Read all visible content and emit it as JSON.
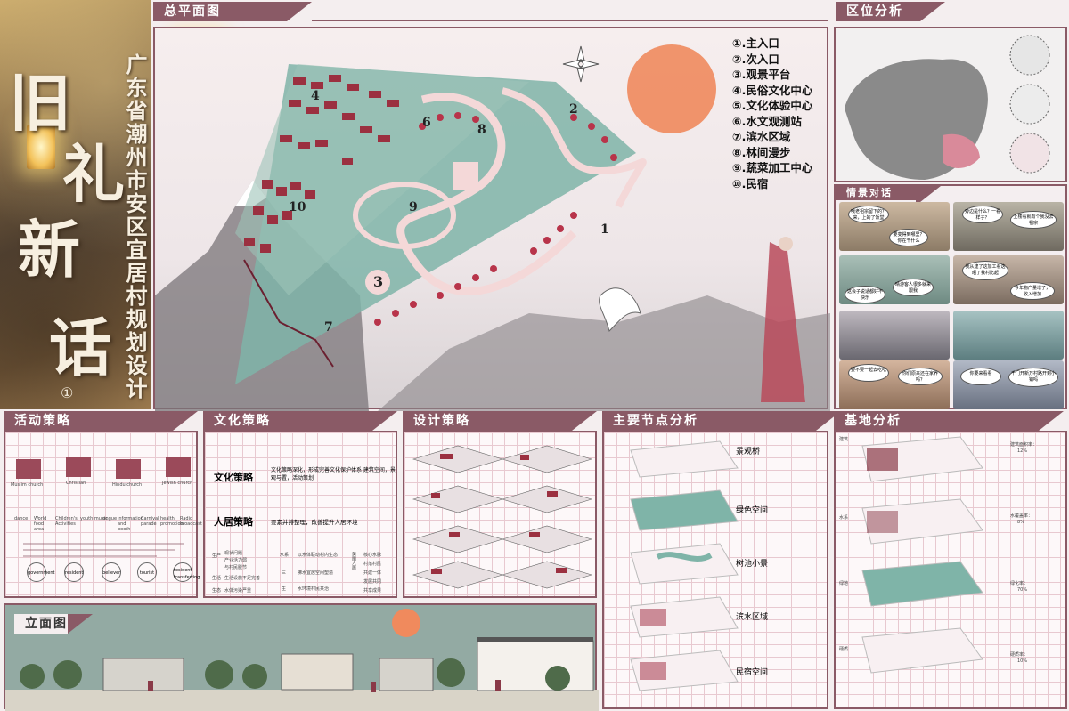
{
  "title_art": {
    "big_chars": [
      "旧",
      "礼",
      "新",
      "话"
    ],
    "vertical_title": "广东省潮州市安区宜居村规划设计",
    "number_mark": "①"
  },
  "sections": {
    "master_plan": "总平面图",
    "location": "区位分析",
    "scene_dialog": "情景对话",
    "activity": "活动策略",
    "culture": "文化策略",
    "design": "设计策略",
    "nodes": "主要节点分析",
    "site": "基地分析",
    "elevation": "立面图"
  },
  "legend": [
    "①.主入口",
    "②.次入口",
    "③.观景平台",
    "④.民俗文化中心",
    "⑤.文化体验中心",
    "⑥.水文观测站",
    "⑦.滨水区域",
    "⑧.林间漫步",
    "⑨.蔬菜加工中心",
    "⑩.民宿"
  ],
  "plan_numbers": [
    "1",
    "2",
    "3",
    "4",
    "6",
    "7",
    "8",
    "9",
    "10"
  ],
  "activity": {
    "churches": [
      "Muslim church",
      "Christian",
      "Hindu church",
      "Jewish church"
    ],
    "activities": [
      "dance",
      "World food area",
      "Children's Activities",
      "youth music",
      "longue",
      "information and booth",
      "Carnival parade",
      "health promotion",
      "Radio broadcast"
    ],
    "stakeholders": [
      "government",
      "resident",
      "believer",
      "tourist",
      "resident transferring"
    ]
  },
  "culture": {
    "row1_label": "文化策略",
    "row1_text": "文化策略深化，形成完善文化保护体系 建筑空间，景观与置，活动策划",
    "row2_label": "人居策略",
    "row2_text": "要素并排整理，改善提升人居环境",
    "tree_left": [
      "现状问题",
      "产业活力弱",
      "与村民脱节"
    ],
    "tree_left_labels": [
      "生产",
      "生活",
      "生态"
    ],
    "tree_left2": [
      "生活设施不足完善",
      "水体污染严重"
    ],
    "tree_mid_labels": [
      "水系",
      "三",
      "生"
    ],
    "tree_mid": [
      "以水体联动村内生态",
      "拂水宜居空间塑造",
      "水环境村民共治"
    ],
    "tree_right_label": "美丽人居",
    "tree_right": [
      "核心水脉",
      "村落村民",
      "共建一体",
      "发展共同",
      "共享成果"
    ]
  },
  "nodes": [
    "景观桥",
    "绿色空间",
    "树池小景",
    "滨水区域",
    "民宿空间"
  ],
  "site": {
    "labels": [
      "建筑",
      "水系",
      "绿地",
      "硬质"
    ],
    "stats": [
      {
        "name": "建筑面积率：",
        "value": "12%"
      },
      {
        "name": "水覆盖率：",
        "value": "8%"
      },
      {
        "name": "绿化率：",
        "value": "70%"
      },
      {
        "name": "硬质率：",
        "value": "10%"
      }
    ]
  },
  "dialog": [
    "哦老祖宗留下的？来，上的了饭堂",
    "旁边是什么？一看样子？",
    "上楼看就有个我没去祖宗",
    "要变得到哪里？你在干什么",
    "我从建了这加工看这晒了我村比起",
    "这会子说适都好不快乐",
    "晴游客人很多就来跟我",
    "今年物产量增了，收入增加",
    "要不要一起去吃吃",
    "你们原来还在家养吗？",
    "你要来看看",
    "千门开新万村路开到小镇吗"
  ],
  "colors": {
    "accent": "#8a5a66",
    "grid": "#e8c9d0",
    "plan_teal": "#7fb4a8",
    "sun": "#f08a5d",
    "roof_red": "#9b3040"
  }
}
